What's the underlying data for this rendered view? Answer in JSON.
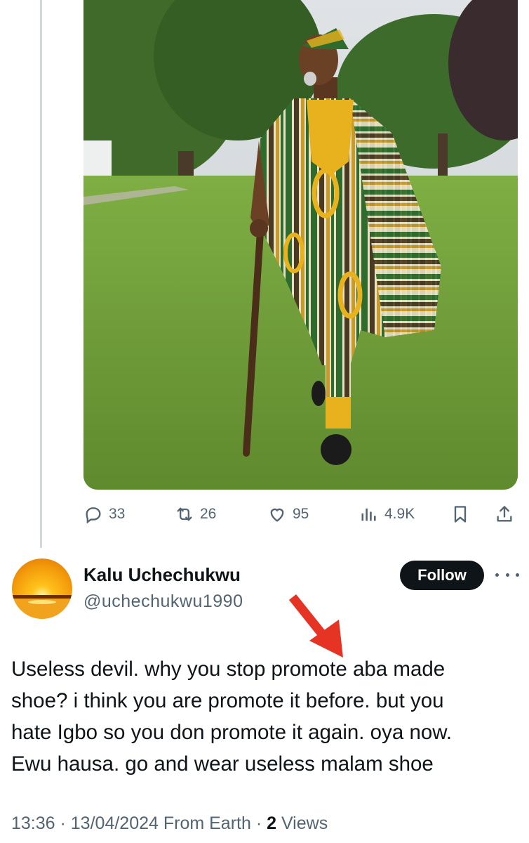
{
  "tweet": {
    "actions": [
      {
        "name": "reply",
        "count": "33"
      },
      {
        "name": "repost",
        "count": "26"
      },
      {
        "name": "like",
        "count": "95"
      },
      {
        "name": "views",
        "count": "4.9K"
      }
    ]
  },
  "reply": {
    "author_name": "Kalu Uchechukwu",
    "author_handle": "@uchechukwu1990",
    "follow_label": "Follow",
    "text": "Useless devil. why you stop promote aba made\nshoe?  i think you are promote it before. but you\nhate Igbo so you don promote it again. oya now.\nEwu hausa. go and wear useless malam shoe",
    "time": "13:36",
    "separator1": " · ",
    "date": "13/04/2024",
    "source": " From Earth",
    "separator2": " · ",
    "views_count": "2",
    "views_label": " Views"
  },
  "colors": {
    "text_primary": "#0f1419",
    "text_secondary": "#536471",
    "follow_bg": "#0f1419",
    "thread_line": "#cfd9de",
    "annotation_arrow": "#e53424"
  },
  "icons": [
    "reply-icon",
    "repost-icon",
    "like-icon",
    "views-icon",
    "bookmark-icon",
    "share-icon",
    "more-icon",
    "arrow-annotation"
  ]
}
